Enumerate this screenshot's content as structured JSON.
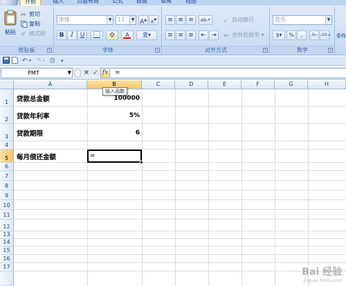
{
  "tabs": [
    "开始",
    "插入",
    "页面布局",
    "公式",
    "数据",
    "审阅",
    "视图"
  ],
  "clipboard": {
    "paste": "粘贴",
    "cut": "剪切",
    "copy": "复制",
    "format_painter": "格式刷",
    "group_label": "剪贴板"
  },
  "font": {
    "name_value": "宋体",
    "size_value": "11",
    "grow": "A",
    "shrink": "A",
    "bold": "B",
    "italic": "I",
    "underline": "U",
    "phonetic": "变",
    "group_label": "字体"
  },
  "alignment": {
    "wrap_text": "自动换行",
    "merge_center": "合并后居中",
    "group_label": "对齐方式"
  },
  "number": {
    "format_value": "货币",
    "percent": "%",
    "comma": ",",
    "group_label": "数字"
  },
  "styles": {
    "partial_label": "条件"
  },
  "formula_bar": {
    "name_box": "PMT",
    "cancel": "✕",
    "enter": "✓",
    "fx": "fx",
    "content": "="
  },
  "tooltip": "插入函数",
  "columns": [
    "A",
    "B",
    "C",
    "D",
    "E",
    "F",
    "G",
    "H"
  ],
  "rows": [
    "1",
    "2",
    "3",
    "4",
    "5",
    "6",
    "7",
    "8",
    "9",
    "10",
    "11",
    "12",
    "13",
    "14",
    "15",
    "16",
    "17"
  ],
  "cells": {
    "a1": "贷款总金额",
    "b1": "100000",
    "a2": "贷款年利率",
    "b2": "5%",
    "a3": "贷款期限",
    "b3": "6",
    "a5": "每月偿还金额",
    "b5": "="
  },
  "watermark": {
    "main": "Bai 经验",
    "sub": "jingyan.baidu.com"
  },
  "colors": {
    "ribbon": "#d3e2f6",
    "header_selected": "#f6c560",
    "text_blue": "#15428b"
  }
}
